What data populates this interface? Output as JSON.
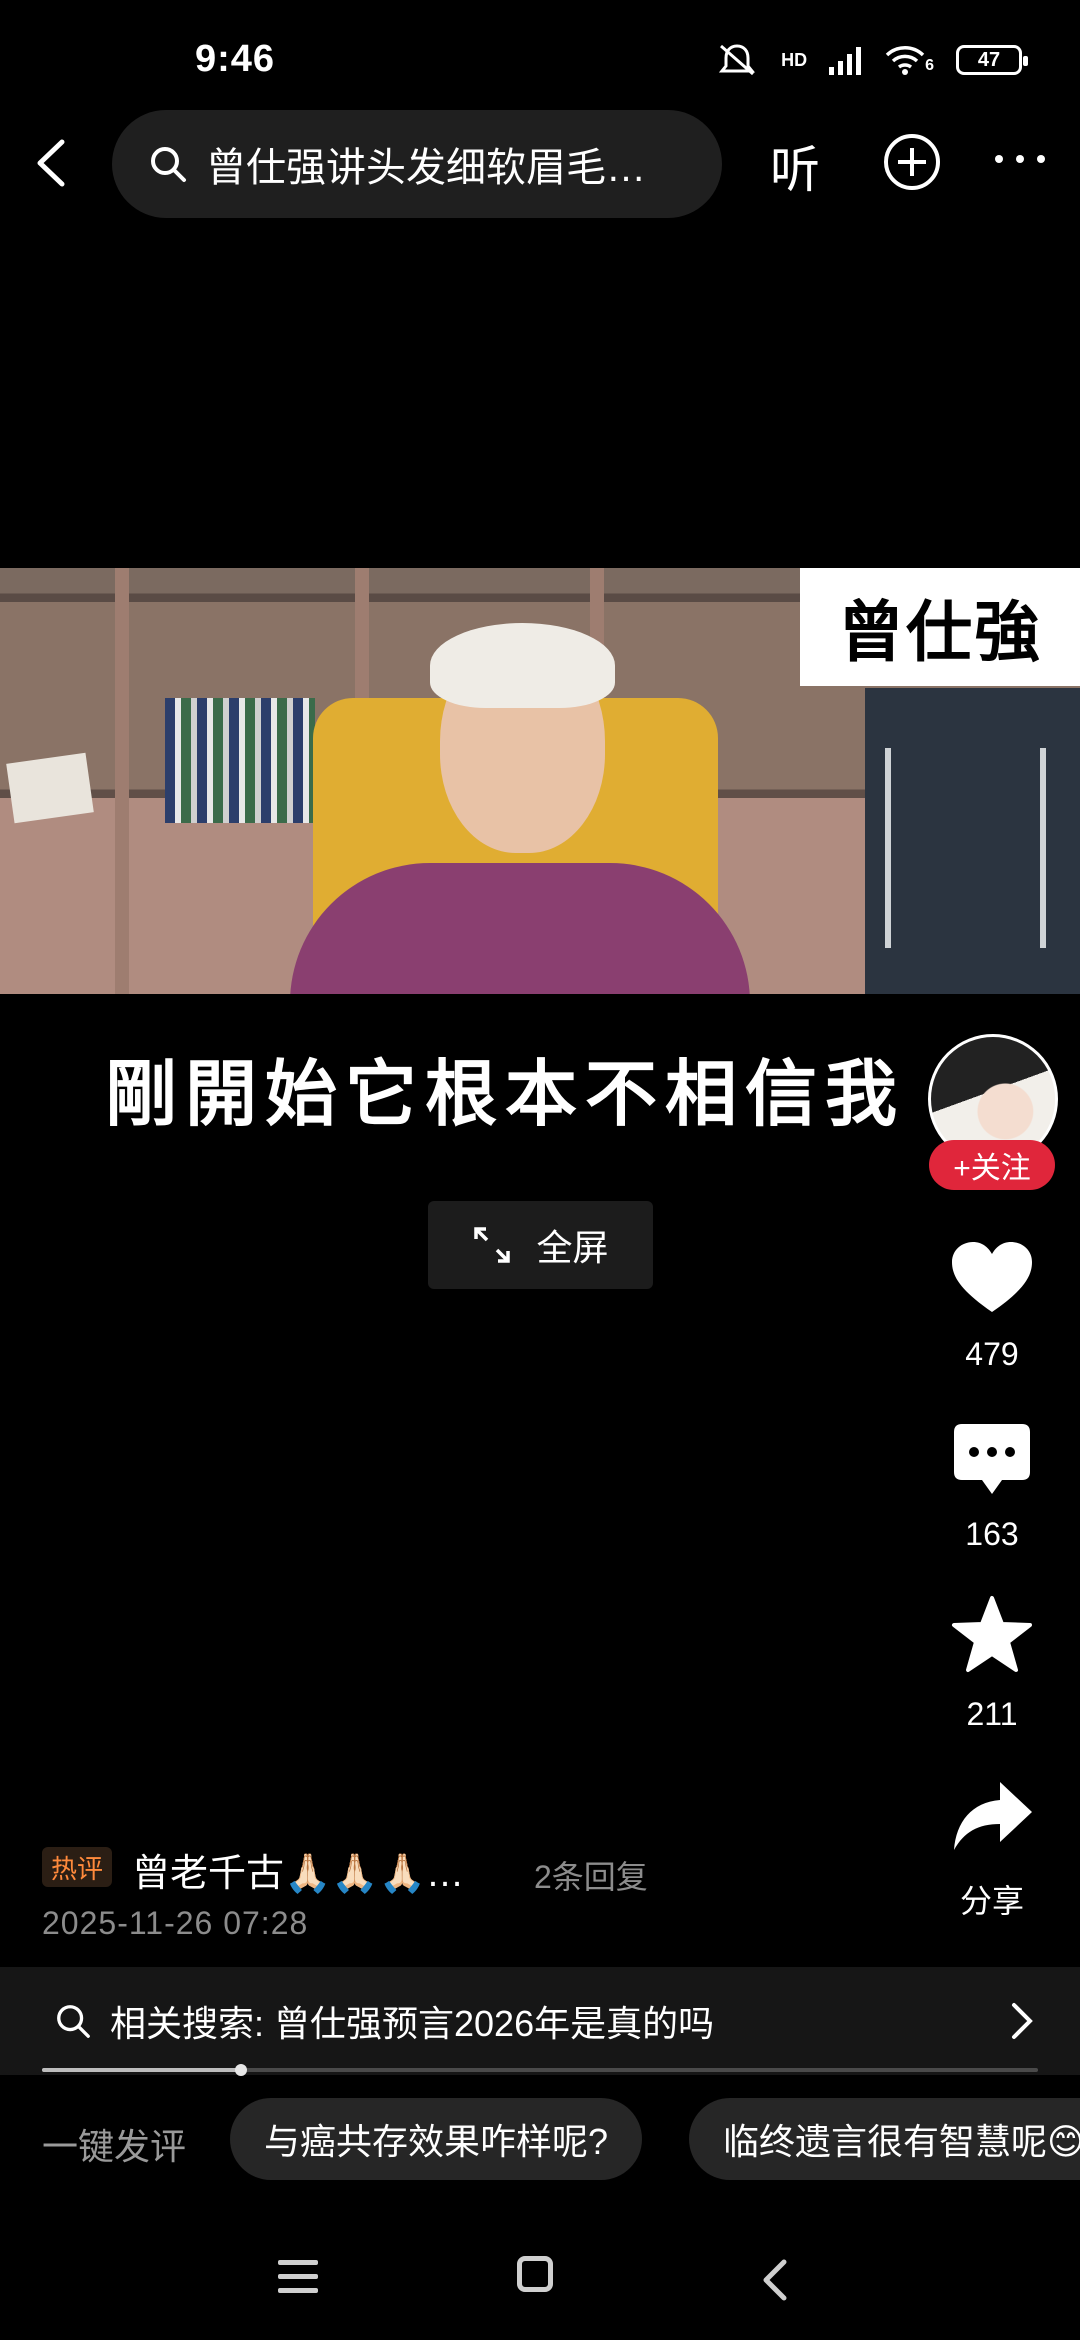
{
  "status_bar": {
    "time": "9:46",
    "battery": "47",
    "network": "HD",
    "wifi_level": "6"
  },
  "top_nav": {
    "search_text": "曾仕强讲头发细软眉毛…",
    "listen_label": "听"
  },
  "video": {
    "name_caption": "曾仕強",
    "subtitle": "剛開始它根本不相信我",
    "fullscreen_label": "全屏"
  },
  "rail": {
    "follow_label": "+关注",
    "likes": "479",
    "comments": "163",
    "favorites": "211",
    "share_label": "分享"
  },
  "hot_comment": {
    "tag": "热评",
    "text": "曾老千古🙏🏻🙏🏻🙏🏻…",
    "replies": "2条回复",
    "timestamp": "2025-11-26 07:28"
  },
  "related_search": {
    "text": "相关搜索: 曾仕强预言2026年是真的吗",
    "progress": 0.2
  },
  "quick_comment": {
    "label": "一键发评",
    "chips": [
      "与癌共存效果咋样呢?",
      "临终遗言很有智慧呢😊"
    ]
  },
  "icons": {
    "back": "chevron-left-icon",
    "search": "search-icon",
    "add": "plus-circle-icon",
    "more": "more-icon",
    "like": "heart-icon",
    "comment": "comment-icon",
    "favorite": "star-icon",
    "share": "share-icon",
    "expand": "expand-icon"
  },
  "colors": {
    "accent": "#e0263b",
    "hot_tag": "#ff8a3c",
    "background": "#000000"
  }
}
